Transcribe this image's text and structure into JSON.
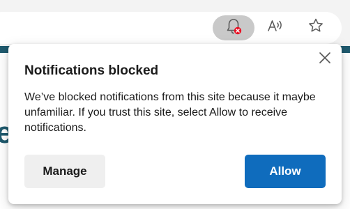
{
  "toolbar": {
    "notification_icon": "bell-blocked-icon",
    "read_aloud_icon": "read-aloud-icon",
    "favorites_icon": "star-icon",
    "blocked_badge_color": "#e81123"
  },
  "page_behind": {
    "visible_letter": "e"
  },
  "flyout": {
    "title": "Notifications blocked",
    "body": "We’ve blocked notifications from this site because it maybe unfamiliar. If you trust this site, select Allow to receive notifications.",
    "manage_label": "Manage",
    "allow_label": "Allow",
    "close_icon": "close-icon",
    "accent_color": "#0f6cbd"
  }
}
